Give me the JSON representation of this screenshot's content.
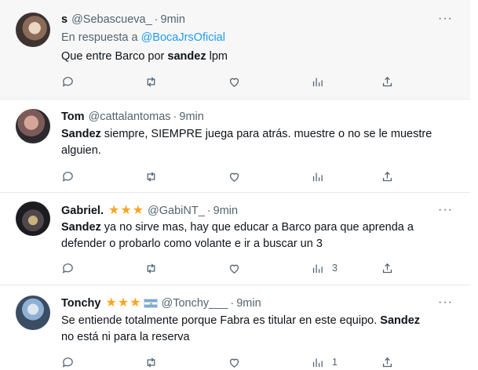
{
  "tweets": [
    {
      "name": "s",
      "handle": "@Sebascueva_",
      "time": "9min",
      "reply_prefix": "En respuesta a",
      "reply_mention": "@BocaJrsOficial",
      "text": {
        "pre": "Que entre Barco por ",
        "bold": "sandez",
        "post": " lpm"
      },
      "stats": {
        "views": ""
      }
    },
    {
      "name": "Tom",
      "handle": "@cattalantomas",
      "time": "9min",
      "text": {
        "bold": "Sandez",
        "post": " siempre, SIEMPRE juega para atrás. muestre o no se le muestre",
        "line2": "alguien."
      },
      "stats": {
        "views": ""
      }
    },
    {
      "name": "Gabriel.",
      "handle": "@GabiNT_",
      "time": "9min",
      "stars": 3,
      "text": {
        "bold": "Sandez",
        "post": " ya no sirve mas, hay que educar a Barco para que aprenda a",
        "line2": "defender o probarlo como volante e ir a buscar un 3"
      },
      "stats": {
        "views": "3"
      }
    },
    {
      "name": "Tonchy",
      "handle": "@Tonchy___",
      "time": "9min",
      "stars": 3,
      "flag": "argentina-flag",
      "text": {
        "pre": "Se entiende totalmente porque Fabra es titular en este equipo. ",
        "bold": "Sandez",
        "line2": "no está ni para la reserva"
      },
      "stats": {
        "views": "1"
      }
    }
  ],
  "shared": {
    "dot": "·",
    "more": "···",
    "star": "★"
  },
  "icons": [
    "reply-icon",
    "retweet-icon",
    "like-icon",
    "views-icon",
    "share-icon",
    "more-icon",
    "star-icon"
  ],
  "colors": {
    "accent": "#1d9bf0",
    "muted": "#536471",
    "star": "#f5a623"
  }
}
